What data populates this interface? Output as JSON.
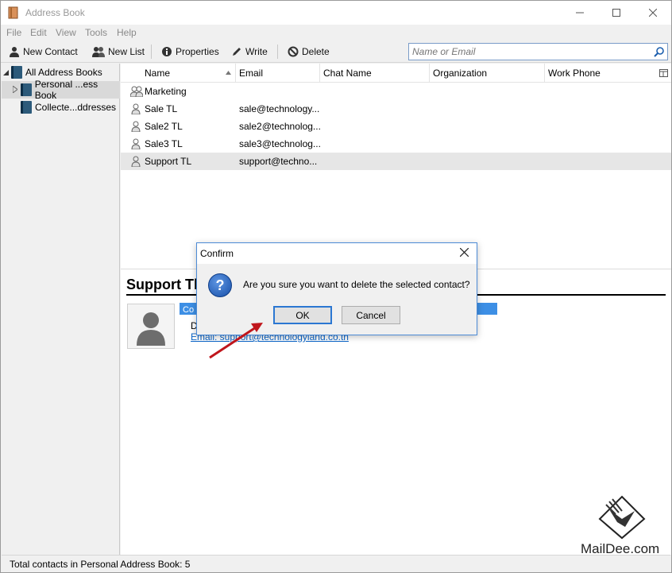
{
  "window": {
    "title": "Address Book"
  },
  "menu": [
    "File",
    "Edit",
    "View",
    "Tools",
    "Help"
  ],
  "toolbar": {
    "new_contact": "New Contact",
    "new_list": "New List",
    "properties": "Properties",
    "write": "Write",
    "delete": "Delete",
    "search_placeholder": "Name or Email"
  },
  "sidebar": {
    "items": [
      {
        "label": "All Address Books"
      },
      {
        "label": "Personal ...ess Book"
      },
      {
        "label": "Collecte...ddresses"
      }
    ]
  },
  "list": {
    "columns": [
      "Name",
      "Email",
      "Chat Name",
      "Organization",
      "Work Phone"
    ],
    "rows": [
      {
        "name": "Marketing",
        "email": "",
        "type": "list"
      },
      {
        "name": "Sale TL",
        "email": "sale@technology...",
        "type": "contact"
      },
      {
        "name": "Sale2 TL",
        "email": "sale2@technolog...",
        "type": "contact"
      },
      {
        "name": "Sale3 TL",
        "email": "sale3@technolog...",
        "type": "contact"
      },
      {
        "name": "Support TL",
        "email": "support@techno...",
        "type": "contact",
        "selected": true
      }
    ]
  },
  "card": {
    "name": "Support Tl",
    "band": "Co",
    "detail": "D",
    "email": "Email: support@technologyland.co.th"
  },
  "status": "Total contacts in Personal Address Book: 5",
  "dialog": {
    "title": "Confirm",
    "message": "Are you sure you want to delete the selected contact?",
    "ok": "OK",
    "cancel": "Cancel"
  },
  "watermark": "MailDee.com",
  "colors": {
    "accent": "#3d8fe5",
    "arrow": "#c0161c",
    "dialog_border": "#4d8bd6"
  }
}
